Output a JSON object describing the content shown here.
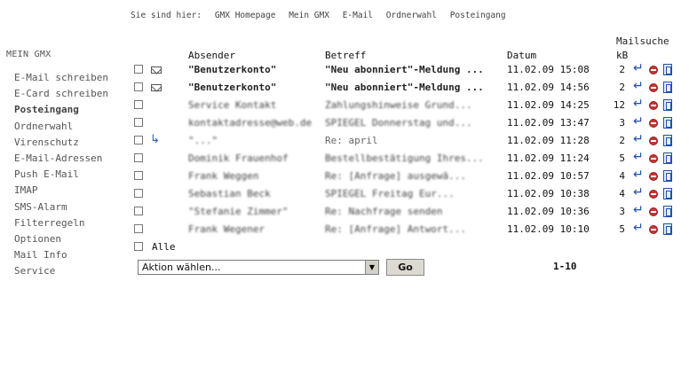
{
  "breadcrumb": {
    "prefix": "Sie sind hier:",
    "items": [
      "GMX Homepage",
      "Mein GMX",
      "E-Mail",
      "Ordnerwahl",
      "Posteingang"
    ]
  },
  "sidebar": {
    "title": "MEIN GMX",
    "items": [
      {
        "label": "E-Mail schreiben",
        "active": false
      },
      {
        "label": "E-Card schreiben",
        "active": false
      },
      {
        "label": "Posteingang",
        "active": true
      },
      {
        "label": "Ordnerwahl",
        "active": false
      },
      {
        "label": "Virenschutz",
        "active": false
      },
      {
        "label": "E-Mail-Adressen",
        "active": false
      },
      {
        "label": "Push E-Mail",
        "active": false
      },
      {
        "label": "IMAP",
        "active": false
      },
      {
        "label": "SMS-Alarm",
        "active": false
      },
      {
        "label": "Filterregeln",
        "active": false
      },
      {
        "label": "Optionen",
        "active": false
      },
      {
        "label": "Mail Info",
        "active": false
      },
      {
        "label": "Service",
        "active": false
      }
    ]
  },
  "mailsuche": "Mailsuche",
  "columns": {
    "sender": "Absender",
    "subject": "Betreff",
    "date": "Datum",
    "size": "kB"
  },
  "rows": [
    {
      "status": "unread",
      "sender": "\"Benutzerkonto\"",
      "subject": "\"Neu abonniert\"-Meldung ...",
      "date": "11.02.09 15:08",
      "kb": "2"
    },
    {
      "status": "unread",
      "sender": "\"Benutzerkonto\"",
      "subject": "\"Neu abonniert\"-Meldung ...",
      "date": "11.02.09 14:56",
      "kb": "2"
    },
    {
      "status": "read",
      "sender": "Service Kontakt",
      "subject": "Zahlungshinweise Grund...",
      "date": "11.02.09 14:25",
      "kb": "12"
    },
    {
      "status": "read",
      "sender": "kontaktadresse@web.de",
      "subject": "SPIEGEL Donnerstag und...",
      "date": "11.02.09 13:47",
      "kb": "3"
    },
    {
      "status": "forwarded",
      "sender": "\"...\"",
      "subject": "Re: april",
      "date": "11.02.09 11:28",
      "kb": "2"
    },
    {
      "status": "read",
      "sender": "Dominik Frauenhof",
      "subject": "Bestellbestätigung Ihres...",
      "date": "11.02.09 11:24",
      "kb": "5"
    },
    {
      "status": "read",
      "sender": "Frank Weggen",
      "subject": "Re: [Anfrage] ausgewä...",
      "date": "11.02.09 10:57",
      "kb": "4"
    },
    {
      "status": "read",
      "sender": "Sebastian Beck",
      "subject": "SPIEGEL Freitag Eur...",
      "date": "11.02.09 10:38",
      "kb": "4"
    },
    {
      "status": "read",
      "sender": "\"Stefanie Zimmer\"",
      "subject": "Re: Nachfrage senden",
      "date": "11.02.09 10:36",
      "kb": "3"
    },
    {
      "status": "read",
      "sender": "Frank Wegener",
      "subject": "Re: [Anfrage] Antwort...",
      "date": "11.02.09 10:10",
      "kb": "5"
    }
  ],
  "select_all_label": "Alle",
  "action": {
    "selected": "Aktion wählen...",
    "go_label": "Go"
  },
  "pager": "1-10",
  "colors": {
    "reply_icon": "#1d4fb0",
    "delete_icon": "#c33333"
  }
}
